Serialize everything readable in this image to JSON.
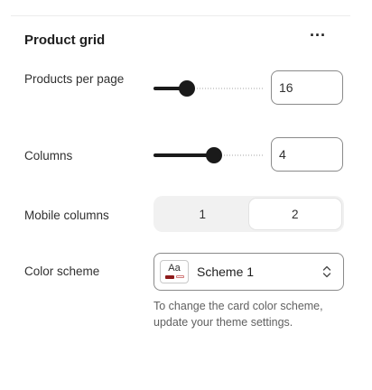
{
  "section": {
    "title": "Product grid",
    "more_label": "···"
  },
  "products_per_page": {
    "label": "Products per page",
    "value": "16",
    "slider_fraction": 0.3
  },
  "columns": {
    "label": "Columns",
    "value": "4",
    "slider_fraction": 0.55
  },
  "mobile_columns": {
    "label": "Mobile columns",
    "options": [
      "1",
      "2"
    ],
    "selected": "2"
  },
  "color_scheme": {
    "label": "Color scheme",
    "swatch_text": "Aa",
    "value": "Scheme 1",
    "help_text": "To change the card color scheme, update your theme settings."
  },
  "colors": {
    "slider_active": "#1a1a1a",
    "swatch_primary": "#8e1b1b",
    "swatch_secondary": "#d17a7a"
  },
  "icons": {
    "more": "more-horizontal-icon",
    "select": "chevron-up-down-icon"
  }
}
